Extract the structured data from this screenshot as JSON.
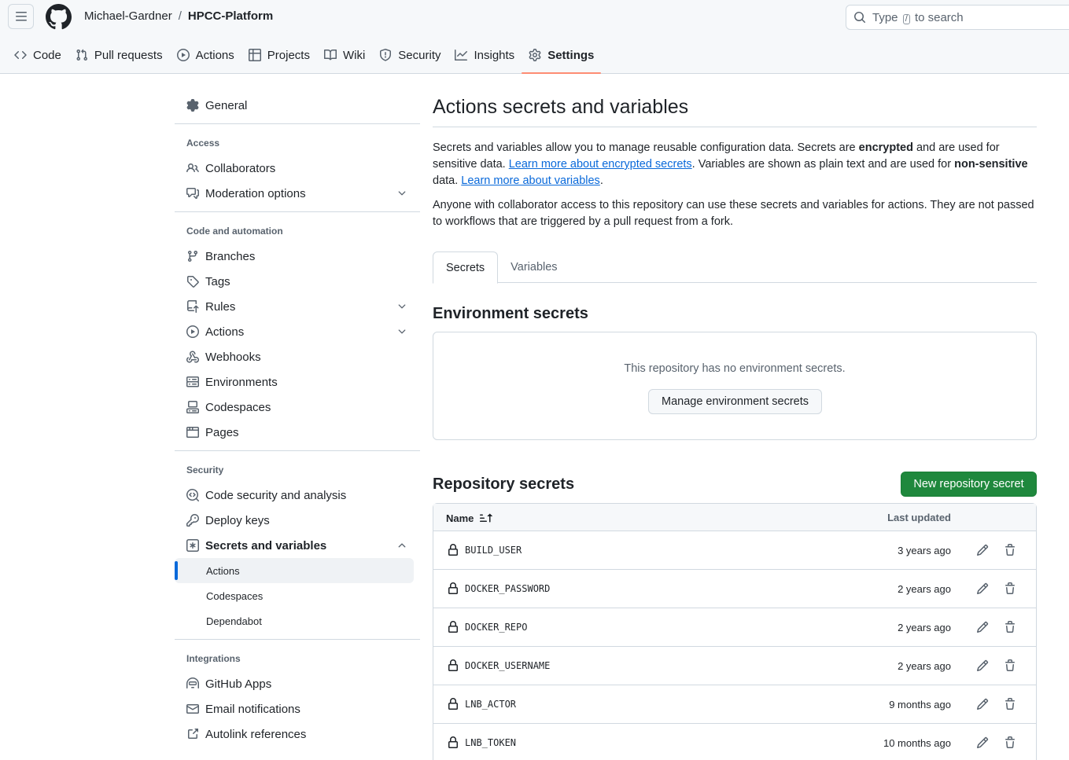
{
  "header": {
    "owner": "Michael-Gardner",
    "separator": "/",
    "repo": "HPCC-Platform",
    "search": {
      "before": "Type",
      "key": "/",
      "after": "to search"
    }
  },
  "nav_tabs": [
    {
      "label": "Code",
      "icon": "code-icon"
    },
    {
      "label": "Pull requests",
      "icon": "git-pull-request-icon"
    },
    {
      "label": "Actions",
      "icon": "play-icon"
    },
    {
      "label": "Projects",
      "icon": "table-icon"
    },
    {
      "label": "Wiki",
      "icon": "book-icon"
    },
    {
      "label": "Security",
      "icon": "shield-icon"
    },
    {
      "label": "Insights",
      "icon": "graph-icon"
    },
    {
      "label": "Settings",
      "icon": "gear-icon",
      "active": true
    }
  ],
  "sidebar": {
    "general": "General",
    "access_heading": "Access",
    "access": [
      "Collaborators",
      "Moderation options"
    ],
    "code_heading": "Code and automation",
    "code": [
      "Branches",
      "Tags",
      "Rules",
      "Actions",
      "Webhooks",
      "Environments",
      "Codespaces",
      "Pages"
    ],
    "security_heading": "Security",
    "security": [
      "Code security and analysis",
      "Deploy keys",
      "Secrets and variables"
    ],
    "secrets_sub": [
      "Actions",
      "Codespaces",
      "Dependabot"
    ],
    "integrations_heading": "Integrations",
    "integrations": [
      "GitHub Apps",
      "Email notifications",
      "Autolink references"
    ]
  },
  "main": {
    "title": "Actions secrets and variables",
    "p1": {
      "t1": "Secrets and variables allow you to manage reusable configuration data. Secrets are ",
      "b1": "encrypted",
      "t2": " and are used for sensitive data. ",
      "link1": "Learn more about encrypted secrets",
      "t3": ". Variables are shown as plain text and are used for ",
      "b2": "non-sensitive",
      "t4": " data. ",
      "link2": "Learn more about variables",
      "t5": "."
    },
    "p2": "Anyone with collaborator access to this repository can use these secrets and variables for actions. They are not passed to workflows that are triggered by a pull request from a fork.",
    "tabs": [
      "Secrets",
      "Variables"
    ],
    "env_heading": "Environment secrets",
    "env_empty": "This repository has no environment secrets.",
    "env_button": "Manage environment secrets",
    "repo_heading": "Repository secrets",
    "new_button": "New repository secret",
    "table_headers": {
      "name": "Name",
      "updated": "Last updated"
    },
    "secrets": [
      {
        "name": "BUILD_USER",
        "updated": "3 years ago"
      },
      {
        "name": "DOCKER_PASSWORD",
        "updated": "2 years ago"
      },
      {
        "name": "DOCKER_REPO",
        "updated": "2 years ago"
      },
      {
        "name": "DOCKER_USERNAME",
        "updated": "2 years ago"
      },
      {
        "name": "LNB_ACTOR",
        "updated": "9 months ago"
      },
      {
        "name": "LNB_TOKEN",
        "updated": "10 months ago"
      }
    ]
  },
  "colors": {
    "accent": "#0969da",
    "primary_button": "#1f883d",
    "active_tab_underline": "#fd8c73"
  }
}
